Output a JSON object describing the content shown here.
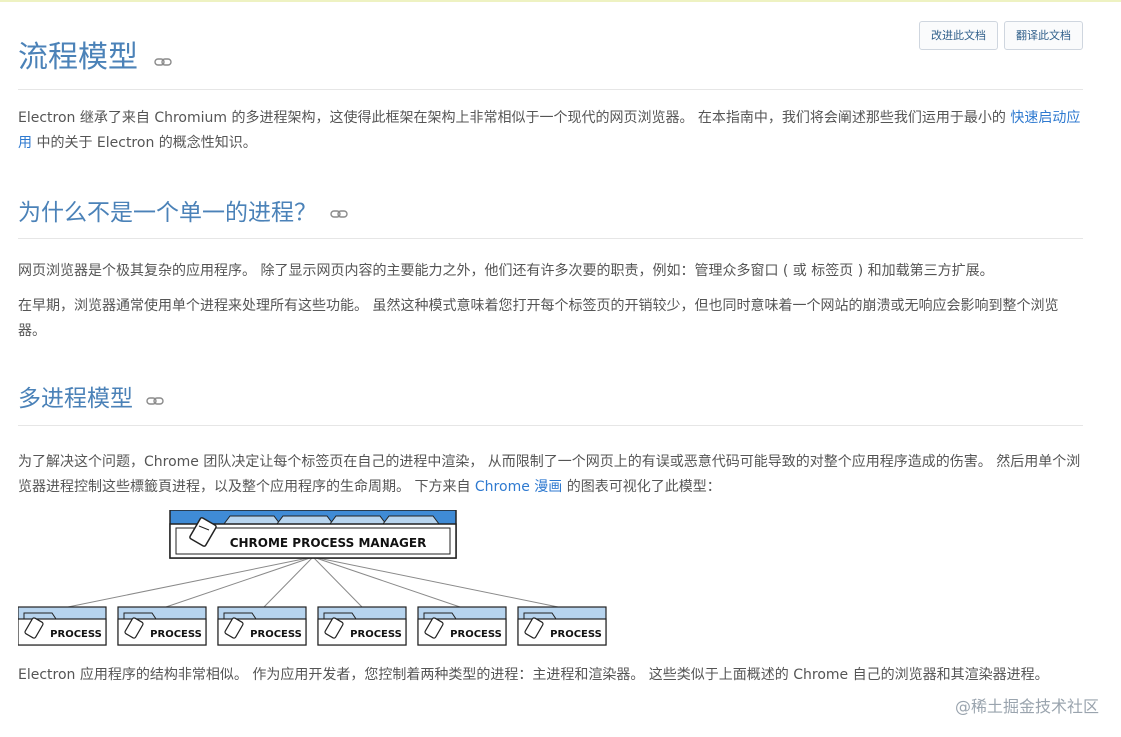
{
  "toolbar": {
    "improve_label": "改进此文档",
    "translate_label": "翻译此文档"
  },
  "page": {
    "title": "流程模型"
  },
  "intro": {
    "text1": "Electron 继承了来自 Chromium 的多进程架构，这使得此框架在架构上非常相似于一个现代的网页浏览器。 在本指南中，我们将会阐述那些我们运用于最小的 ",
    "link": "快速启动应用",
    "text2": " 中的关于 Electron 的概念性知识。"
  },
  "section1": {
    "heading": "为什么不是一个单一的进程？",
    "p1": "网页浏览器是个极其复杂的应用程序。 除了显示网页内容的主要能力之外，他们还有许多次要的职责，例如：管理众多窗口 ( 或 标签页 ) 和加载第三方扩展。",
    "p2": "在早期，浏览器通常使用单个进程来处理所有这些功能。 虽然这种模式意味着您打开每个标签页的开销较少，但也同时意味着一个网站的崩溃或无响应会影响到整个浏览器。"
  },
  "section2": {
    "heading": "多进程模型",
    "p1_text1": "为了解决这个问题，Chrome 团队决定让每个标签页在自己的进程中渲染， 从而限制了一个网页上的有误或恶意代码可能导致的对整个应用程序造成的伤害。 然后用单个浏览器进程控制这些標籤頁进程，以及整个应用程序的生命周期。 下方来自 ",
    "p1_link": "Chrome 漫画",
    "p1_text2": " 的图表可视化了此模型：",
    "diagram": {
      "manager_label": "CHROME PROCESS MANAGER",
      "process_labels": [
        "PROCESS",
        "PROCESS",
        "PROCESS",
        "PROCESS",
        "PROCESS",
        "PROCESS"
      ]
    },
    "p2": "Electron 应用程序的结构非常相似。 作为应用开发者，您控制着两种类型的进程：主进程和渲染器。 这些类似于上面概述的 Chrome 自己的浏览器和其渲染器进程。"
  },
  "watermark": "@稀土掘金技术社区",
  "icons": {
    "anchor": "link-icon",
    "card": "card-icon"
  },
  "colors": {
    "heading": "#4b82b8",
    "link": "#2f7ad0",
    "diagram_blue": "#3f8bd6",
    "diagram_light": "#b7d4ee"
  }
}
